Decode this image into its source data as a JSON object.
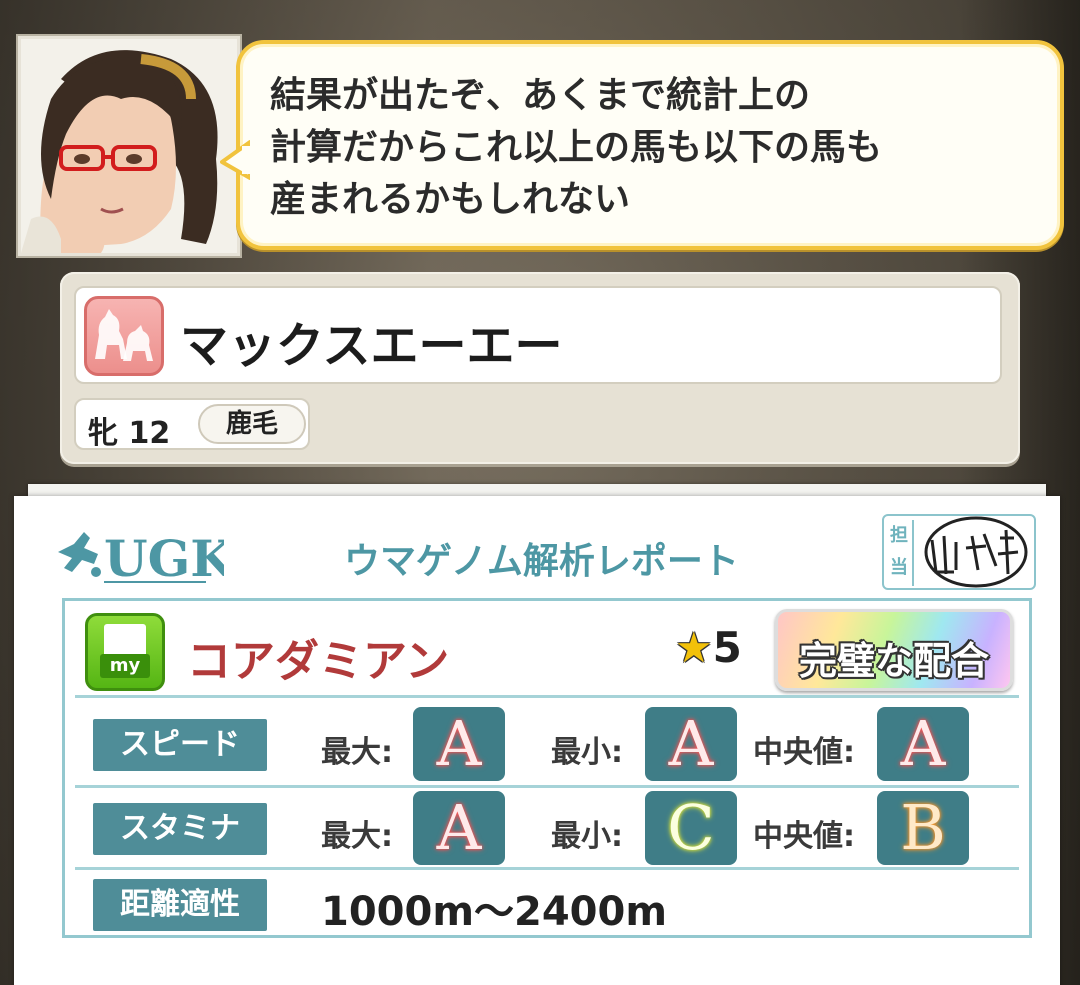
{
  "dialog": {
    "lines": [
      "結果が出たぞ、あくまで統計上の",
      "計算だからこれ以上の馬も以下の馬も",
      "産まれるかもしれない"
    ]
  },
  "horse": {
    "name": "マックスエーエー",
    "sex_age": "牝 12",
    "coat": "鹿毛"
  },
  "report": {
    "logo": "UGK",
    "title": "ウマゲノム解析レポート",
    "stamp_label": "担当",
    "stamp_signature": "山科",
    "sire": {
      "icon_label": "my",
      "name": "コアダミアン",
      "stars_symbol": "★",
      "stars": "5",
      "badge": "完璧な配合"
    },
    "labels": {
      "max": "最大:",
      "min": "最小:",
      "median": "中央値:"
    },
    "rows": [
      {
        "label": "スピード",
        "max": "A",
        "min": "A",
        "median": "A"
      },
      {
        "label": "スタミナ",
        "max": "A",
        "min": "C",
        "median": "B"
      }
    ],
    "distance": {
      "label": "距離適性",
      "value": "1000m〜2400m"
    }
  },
  "colors": {
    "bubble_border": "#f1c33d",
    "report_accent": "#4d97a4",
    "sire_name": "#b13a3a",
    "grade_bg": "#3f7d87"
  },
  "icons": [
    "horse-pair-icon",
    "my-document-icon",
    "ugk-runner-logo",
    "star-icon"
  ]
}
